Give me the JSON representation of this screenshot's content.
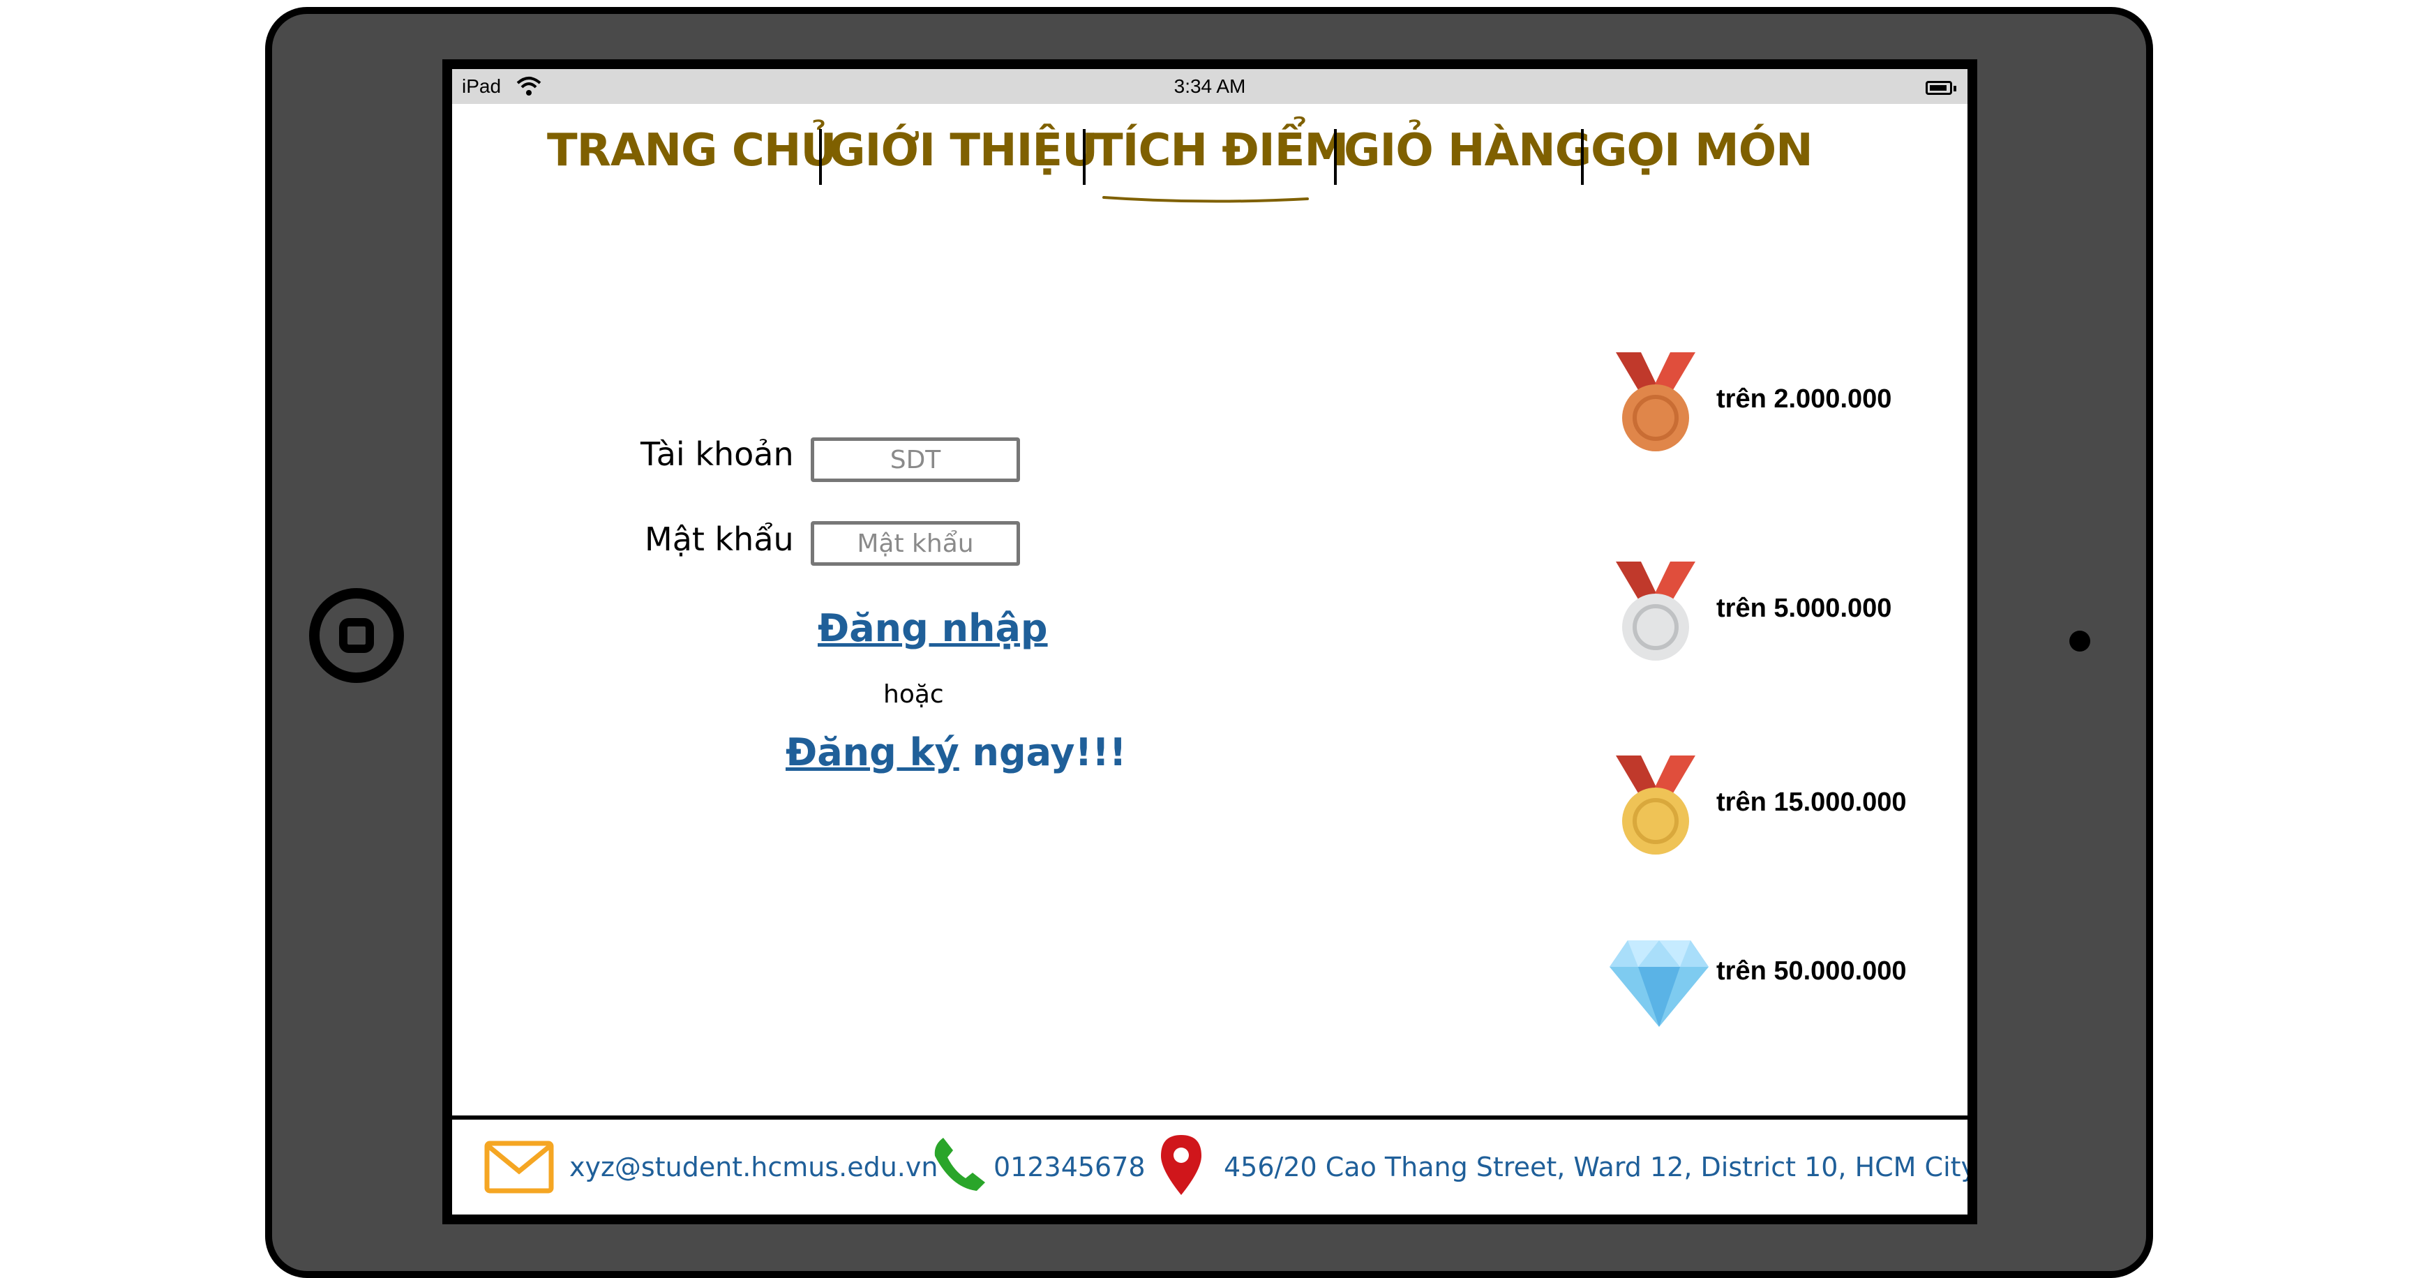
{
  "status_bar": {
    "carrier": "iPad",
    "time": "3:34 AM"
  },
  "nav": {
    "items": [
      {
        "label": "TRANG CHỦ"
      },
      {
        "label": "GIỚI THIỆU"
      },
      {
        "label": "TÍCH ĐIỂM",
        "active": true
      },
      {
        "label": "GIỎ HÀNG"
      },
      {
        "label": "GỌI MÓN"
      }
    ],
    "color": "#7f6000"
  },
  "login": {
    "account_label": "Tài khoản",
    "account_placeholder": "SDT",
    "password_label": "Mật khẩu",
    "password_placeholder": "Mật khẩu",
    "login_link": "Đăng nhập",
    "or_text": "hoặc",
    "signup_link": "Đăng ký",
    "signup_suffix": " ngay!!!",
    "link_color": "#1f5f99"
  },
  "tiers": [
    {
      "icon": "bronze-medal-icon",
      "text": "trên 2.000.000"
    },
    {
      "icon": "silver-medal-icon",
      "text": "trên 5.000.000"
    },
    {
      "icon": "gold-medal-icon",
      "text": "trên 15.000.000"
    },
    {
      "icon": "diamond-icon",
      "text": "trên 50.000.000"
    }
  ],
  "footer": {
    "email": "xyz@student.hcmus.edu.vn",
    "phone": "012345678",
    "address": "456/20 Cao Thang Street, Ward 12, District 10, HCM City"
  }
}
